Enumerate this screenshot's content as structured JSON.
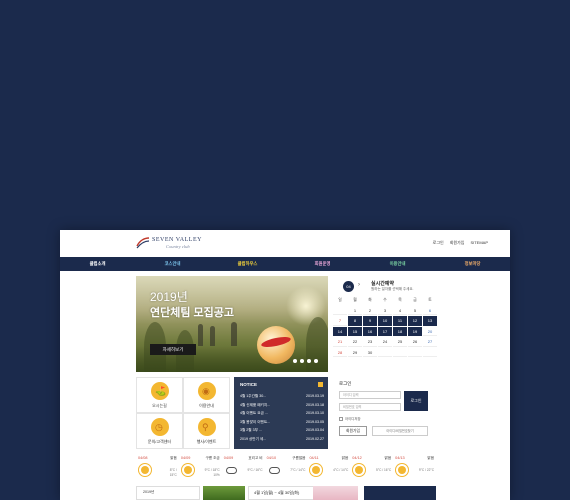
{
  "header": {
    "logo_text": "SEVEN VALLEY",
    "logo_sub": "Country club",
    "links": [
      "로그인",
      "회원가입",
      "SITEMAP"
    ]
  },
  "gnb": {
    "items": [
      {
        "label": "클럽소개",
        "color": "#ffffff"
      },
      {
        "label": "코스안내",
        "color": "#7ec8f0"
      },
      {
        "label": "클럽하우스",
        "color": "#f3d23b"
      },
      {
        "label": "회원운영",
        "color": "#e9a6d8"
      },
      {
        "label": "이용안내",
        "color": "#7fdca6"
      },
      {
        "label": "정보마당",
        "color": "#f4b06a"
      }
    ]
  },
  "hero": {
    "year": "2019년",
    "title": "연단체팀 모집공고",
    "button": "자세히보기",
    "slide_count": 4
  },
  "reservation": {
    "month": "04",
    "title": "실시간예약",
    "desc": "원하는 일자를 선택해 주세요.",
    "weekdays": [
      "일",
      "월",
      "화",
      "수",
      "목",
      "금",
      "토"
    ],
    "days": [
      {
        "d": "",
        "on": false
      },
      {
        "d": "1",
        "on": false
      },
      {
        "d": "2",
        "on": false
      },
      {
        "d": "3",
        "on": false
      },
      {
        "d": "4",
        "on": false
      },
      {
        "d": "5",
        "on": false
      },
      {
        "d": "6",
        "on": false
      },
      {
        "d": "7",
        "on": false
      },
      {
        "d": "8",
        "on": true
      },
      {
        "d": "9",
        "on": true
      },
      {
        "d": "10",
        "on": true
      },
      {
        "d": "11",
        "on": true
      },
      {
        "d": "12",
        "on": true
      },
      {
        "d": "13",
        "on": true
      },
      {
        "d": "14",
        "on": true
      },
      {
        "d": "15",
        "on": true
      },
      {
        "d": "16",
        "on": true
      },
      {
        "d": "17",
        "on": true
      },
      {
        "d": "18",
        "on": true
      },
      {
        "d": "19",
        "on": true
      },
      {
        "d": "20",
        "on": false
      },
      {
        "d": "21",
        "on": false
      },
      {
        "d": "22",
        "on": false
      },
      {
        "d": "23",
        "on": false
      },
      {
        "d": "24",
        "on": false
      },
      {
        "d": "25",
        "on": false
      },
      {
        "d": "26",
        "on": false
      },
      {
        "d": "27",
        "on": false
      },
      {
        "d": "28",
        "on": false
      },
      {
        "d": "29",
        "on": false
      },
      {
        "d": "30",
        "on": false
      },
      {
        "d": "",
        "on": false
      },
      {
        "d": "",
        "on": false
      },
      {
        "d": "",
        "on": false
      },
      {
        "d": "",
        "on": false
      }
    ]
  },
  "quick_menu": [
    {
      "label": "오시는길",
      "icon": "map-icon",
      "glyph": "⛳"
    },
    {
      "label": "이용안내",
      "icon": "location-pin-icon",
      "glyph": "◉"
    },
    {
      "label": "문의/고객센터",
      "icon": "clock-icon",
      "glyph": "◷"
    },
    {
      "label": "행사/이벤트",
      "icon": "search-icon",
      "glyph": "⚲"
    }
  ],
  "notice": {
    "title": "NOTICE",
    "rows": [
      {
        "text": "4월 1주간월 30...",
        "date": "2019.03.19"
      },
      {
        "text": "4월 신제품 페키지...",
        "date": "2019.03.18"
      },
      {
        "text": "4월 이벤트 요금 ...",
        "date": "2019.03.10"
      },
      {
        "text": "3월 봄맞이 이벤트...",
        "date": "2019.03.05"
      },
      {
        "text": "3월 2월 3부 ...",
        "date": "2019.03.04"
      },
      {
        "text": "2019 상반기 세...",
        "date": "2019.02.27"
      }
    ]
  },
  "login": {
    "title": "로그인",
    "id_placeholder": "아이디 입력",
    "pw_placeholder": "비밀번호 입력",
    "button": "로그인",
    "remember": "아이디저장",
    "join": "회원가입",
    "find": "아이디/비밀번호찾기"
  },
  "weather": [
    {
      "date": "04/08",
      "cond": "맑음",
      "temp1": "8°C /",
      "temp2": "15°C",
      "icon": "sun-icon",
      "red": true
    },
    {
      "date": "04/09",
      "cond": "구름 조금",
      "temp1": "9°C / 18°C",
      "temp2": "10%",
      "icon": "sun-cloud-icon",
      "red": true
    },
    {
      "date": "04/09",
      "cond": "흐리고 비",
      "temp1": "9°C / 16°C",
      "temp2": "",
      "icon": "rain-cloud-icon",
      "red": true
    },
    {
      "date": "04/10",
      "cond": "구름많음",
      "temp1": "7°C / 14°C",
      "temp2": "",
      "icon": "cloud-icon",
      "red": true
    },
    {
      "date": "04/11",
      "cond": "맑음",
      "temp1": "4°C / 14°C",
      "temp2": "",
      "icon": "sun-icon",
      "red": true
    },
    {
      "date": "04/12",
      "cond": "맑음",
      "temp1": "5°C / 16°C",
      "temp2": "",
      "icon": "sun-icon",
      "red": true
    },
    {
      "date": "04/13",
      "cond": "맑음",
      "temp1": "9°C / 22°C",
      "temp2": "",
      "icon": "sun-icon",
      "red": true
    }
  ],
  "bottom": {
    "left": "2019년",
    "middle": "4월 1일(월) ~ 4월 30일(화)"
  }
}
